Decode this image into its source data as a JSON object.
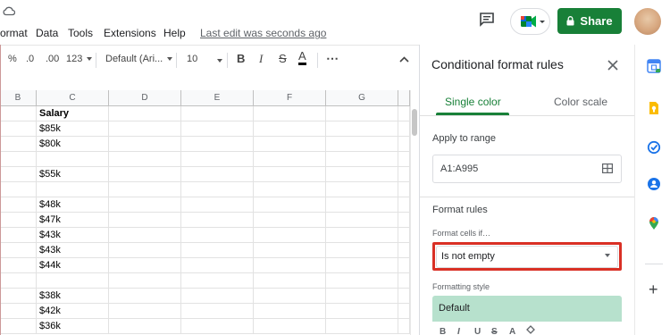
{
  "menubar": {
    "items": [
      "ormat",
      "Data",
      "Tools",
      "Extensions",
      "Help"
    ],
    "last_edit": "Last edit was seconds ago"
  },
  "header": {
    "share_label": "Share"
  },
  "toolbar": {
    "percent": "%",
    "decrease_decimals": ".0",
    "increase_decimals": ".00",
    "more_formats": "123",
    "font_family": "Default (Ari...",
    "font_size": "10",
    "bold": "B",
    "italic": "I",
    "strikethrough": "S",
    "text_color": "A",
    "more": "⋯"
  },
  "grid": {
    "columns": [
      "B",
      "C",
      "D",
      "E",
      "F",
      "G"
    ],
    "rows": [
      {
        "c": "Salary",
        "bold": true
      },
      {
        "c": "$85k"
      },
      {
        "c": "$80k"
      },
      {
        "c": ""
      },
      {
        "c": "$55k"
      },
      {
        "c": ""
      },
      {
        "c": "$48k"
      },
      {
        "c": "$47k"
      },
      {
        "c": "$43k"
      },
      {
        "c": "$43k"
      },
      {
        "c": "$44k"
      },
      {
        "c": ""
      },
      {
        "c": "$38k"
      },
      {
        "c": "$42k"
      },
      {
        "c": "$36k"
      }
    ]
  },
  "panel": {
    "title": "Conditional format rules",
    "tabs": [
      "Single color",
      "Color scale"
    ],
    "apply_to_range_label": "Apply to range",
    "range_value": "A1:A995",
    "format_rules_label": "Format rules",
    "format_cells_if_label": "Format cells if…",
    "condition_value": "Is not empty",
    "formatting_style_label": "Formatting style",
    "style_value": "Default",
    "style_tools": [
      "B",
      "I",
      "U",
      "S",
      "A"
    ]
  },
  "colors": {
    "share_green": "#188038",
    "highlight_red": "#d93025",
    "style_fill": "#b7e1cd"
  },
  "rail": {
    "icons": [
      "calendar-icon",
      "keep-icon",
      "tasks-icon",
      "contacts-icon",
      "maps-icon",
      "add-icon"
    ],
    "add_label": "+"
  }
}
